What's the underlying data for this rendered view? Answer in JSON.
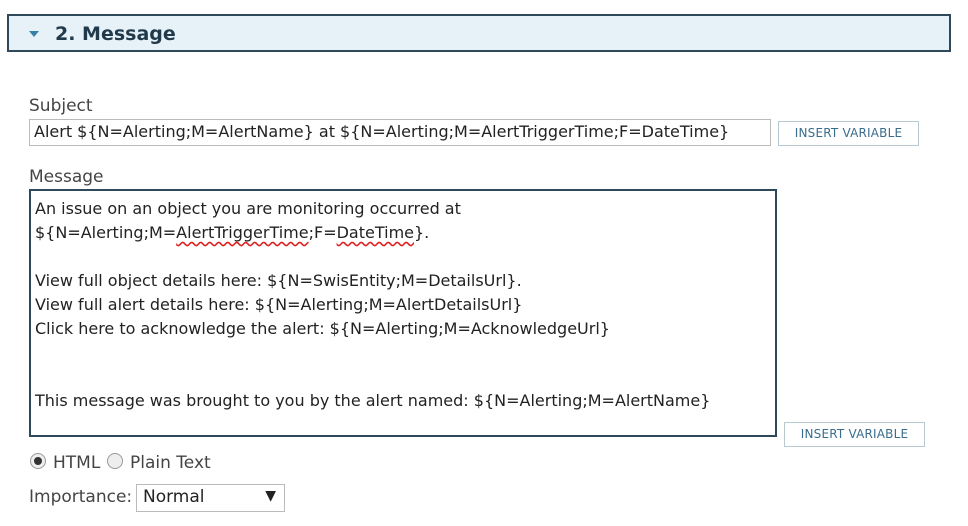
{
  "section": {
    "title": "2. Message",
    "icon": "caret-down-icon"
  },
  "subject": {
    "label": "Subject",
    "value": "Alert ${N=Alerting;M=AlertName} at ${N=Alerting;M=AlertTriggerTime;F=DateTime}",
    "insert_label": "INSERT VARIABLE"
  },
  "message": {
    "label": "Message",
    "line1": "An issue on an object you are monitoring occurred at",
    "line2a": "${N=Alerting;M=",
    "line2b": "AlertTriggerTime",
    "line2c": ";F=",
    "line2d": "DateTime",
    "line2e": "}.",
    "line3": "",
    "line4": "View full object details here: ${N=SwisEntity;M=DetailsUrl}.",
    "line5": "View full alert details here: ${N=Alerting;M=AlertDetailsUrl}",
    "line6": "Click here to acknowledge the alert: ${N=Alerting;M=AcknowledgeUrl}",
    "line7": "",
    "line8": "",
    "line9": "This message was brought to you by the alert named: ${N=Alerting;M=AlertName}",
    "insert_label": "INSERT VARIABLE"
  },
  "format": {
    "html_label": "HTML",
    "plain_label": "Plain Text",
    "selected": "HTML"
  },
  "importance": {
    "label": "Importance:",
    "value": "Normal"
  }
}
